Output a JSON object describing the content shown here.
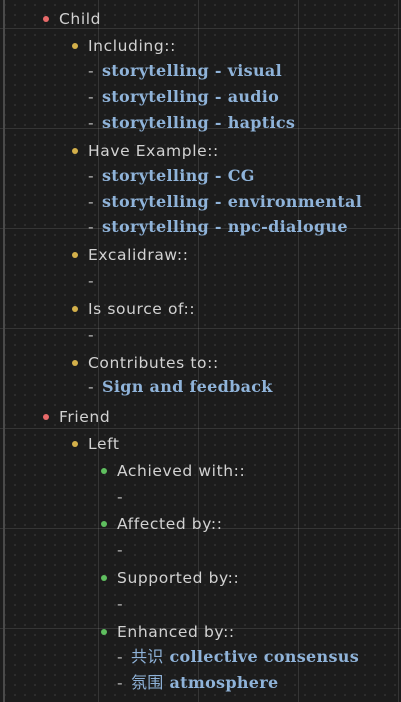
{
  "outline": {
    "child": {
      "label": "Child",
      "including": {
        "label": "Including::",
        "items": [
          "storytelling - visual",
          "storytelling - audio",
          "storytelling - haptics"
        ]
      },
      "have_example": {
        "label": "Have Example::",
        "items": [
          "storytelling - CG",
          "storytelling - environmental",
          "storytelling - npc-dialogue"
        ]
      },
      "excalidraw": {
        "label": "Excalidraw::",
        "value": "-"
      },
      "is_source_of": {
        "label": "Is source of::",
        "value": "-"
      },
      "contributes_to": {
        "label": "Contributes to::",
        "items": [
          "Sign and feedback"
        ]
      }
    },
    "friend": {
      "label": "Friend",
      "left": {
        "label": "Left",
        "achieved_with": {
          "label": "Achieved with::",
          "value": "-"
        },
        "affected_by": {
          "label": "Affected by::",
          "value": "-"
        },
        "supported_by": {
          "label": "Supported by::",
          "value": "-"
        },
        "enhanced_by": {
          "label": "Enhanced by::",
          "items": [
            {
              "cjk": "共识",
              "text": "collective consensus"
            },
            {
              "cjk": "氛围",
              "text": "atmosphere"
            }
          ]
        }
      }
    }
  },
  "colors": {
    "background": "#1c1c1c",
    "bullet_level1": "#e86a6a",
    "bullet_level2": "#d4b04a",
    "bullet_level3": "#5fbf5f",
    "link": "#8fb3d9",
    "text": "#d2d2d2"
  }
}
